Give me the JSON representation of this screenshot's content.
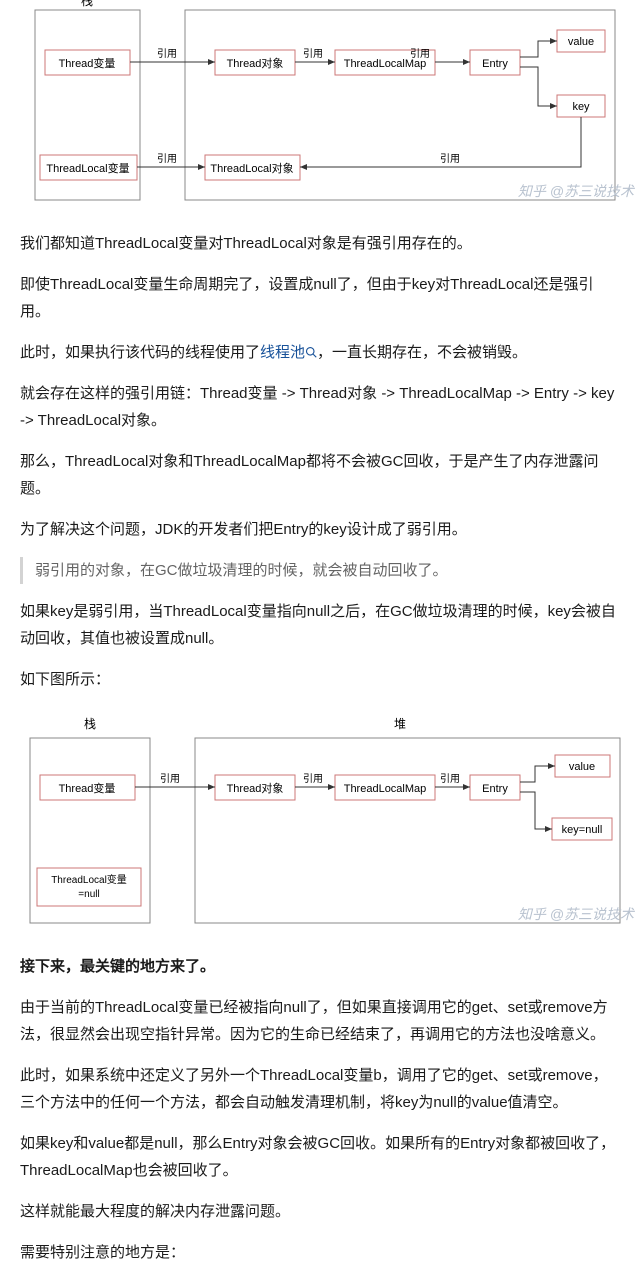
{
  "diagram1": {
    "stack_label": "栈",
    "ref_label": "引用",
    "thread_var": "Thread变量",
    "threadlocal_var": "ThreadLocal变量",
    "thread_obj": "Thread对象",
    "threadlocal_obj": "ThreadLocal对象",
    "threadlocal_map": "ThreadLocalMap",
    "entry": "Entry",
    "value": "value",
    "key": "key",
    "watermark": "知乎 @苏三说技术"
  },
  "p1": "我们都知道ThreadLocal变量对ThreadLocal对象是有强引用存在的。",
  "p2": "即使ThreadLocal变量生命周期完了，设置成null了，但由于key对ThreadLocal还是强引用。",
  "p3a": "此时，如果执行该代码的线程使用了",
  "p3_link": "线程池",
  "p3b": "，一直长期存在，不会被销毁。",
  "p4": "就会存在这样的强引用链：Thread变量 -> Thread对象 -> ThreadLocalMap -> Entry -> key -> ThreadLocal对象。",
  "p5": "那么，ThreadLocal对象和ThreadLocalMap都将不会被GC回收，于是产生了内存泄露问题。",
  "p6": "为了解决这个问题，JDK的开发者们把Entry的key设计成了弱引用。",
  "quote1": "弱引用的对象，在GC做垃圾清理的时候，就会被自动回收了。",
  "p7": "如果key是弱引用，当ThreadLocal变量指向null之后，在GC做垃圾清理的时候，key会被自动回收，其值也被设置成null。",
  "p8": "如下图所示：",
  "diagram2": {
    "stack_label": "栈",
    "heap_label": "堆",
    "ref_label": "引用",
    "thread_var": "Thread变量",
    "threadlocal_var_null": "ThreadLocal变量\n=null",
    "thread_obj": "Thread对象",
    "threadlocal_map": "ThreadLocalMap",
    "entry": "Entry",
    "value": "value",
    "key_null": "key=null",
    "watermark": "知乎 @苏三说技术"
  },
  "p9": "接下来，最关键的地方来了。",
  "p10": "由于当前的ThreadLocal变量已经被指向null了，但如果直接调用它的get、set或remove方法，很显然会出现空指针异常。因为它的生命已经结束了，再调用它的方法也没啥意义。",
  "p11": "此时，如果系统中还定义了另外一个ThreadLocal变量b，调用了它的get、set或remove，三个方法中的任何一个方法，都会自动触发清理机制，将key为null的value值清空。",
  "p12": "如果key和value都是null，那么Entry对象会被GC回收。如果所有的Entry对象都被回收了，ThreadLocalMap也会被回收了。",
  "p13": "这样就能最大程度的解决内存泄露问题。",
  "p14": "需要特别注意的地方是："
}
